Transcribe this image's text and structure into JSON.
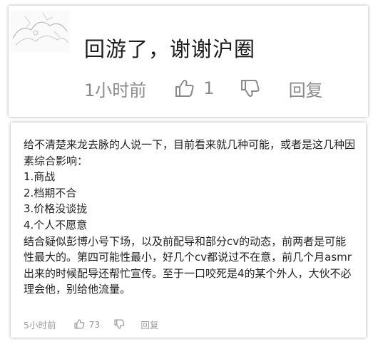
{
  "top_comment": {
    "text": "回游了，谢谢沪圈",
    "time": "1小时前",
    "like_count": "1",
    "reply_label": "回复",
    "icons": {
      "like": "thumbs-up-icon",
      "dislike": "thumbs-down-icon"
    }
  },
  "bottom_comment": {
    "lines": [
      "给不清楚来龙去脉的人说一下，目前看来就几种可能，或者是这几种因素综合影响：",
      "1.商战",
      "2.档期不合",
      "3.价格没谈拢",
      "4.个人不愿意",
      "结合疑似彭博小号下场，以及前配导和部分cv的动态，前两者是可能性最大的。第四可能性最小，好几个cv都说过不在意，前几个月asmr出来的时候配导还帮忙宣传。至于一口咬死是4的某个外人，大伙不必理会他，别给他流量。"
    ],
    "time": "5小时前",
    "like_count": "73",
    "reply_label": "回复",
    "icons": {
      "like": "thumbs-up-icon",
      "dislike": "thumbs-down-icon"
    }
  },
  "colors": {
    "meta_text": "#8a8a8a",
    "body_text": "#1f1f1f",
    "card_shadow": "#999999"
  }
}
